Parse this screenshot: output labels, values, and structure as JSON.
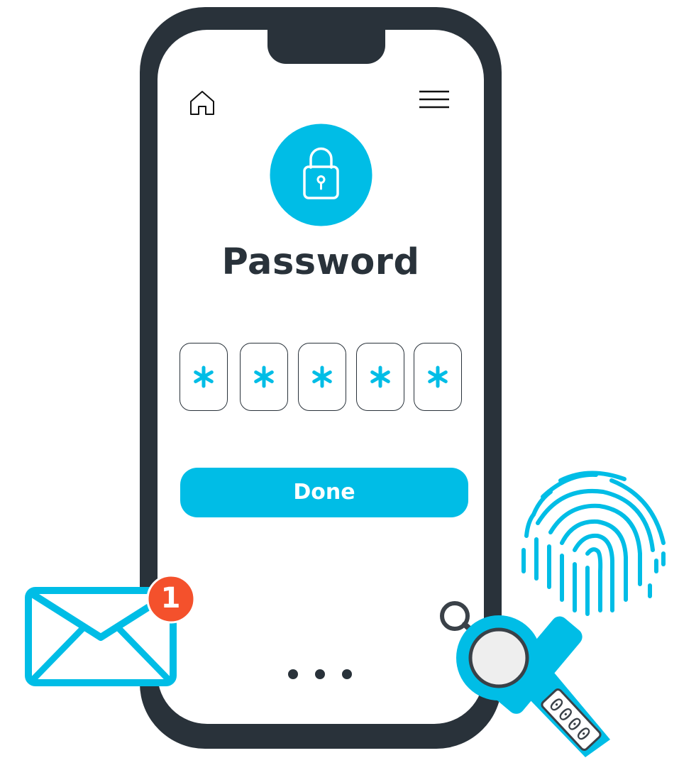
{
  "screen": {
    "title": "Password",
    "pin_chars": [
      "*",
      "*",
      "*",
      "*",
      "*"
    ],
    "done_label": "Done",
    "page_dots": 3
  },
  "notification": {
    "count": "1"
  },
  "key_tag": {
    "text": "0000"
  },
  "icons": {
    "home": "home-icon",
    "menu": "hamburger-menu-icon",
    "lock": "padlock-icon",
    "mail": "envelope-icon",
    "fingerprint": "fingerprint-icon",
    "key": "key-tag-icon"
  },
  "colors": {
    "accent": "#00bde6",
    "dark": "#29323a",
    "badge": "#f4512c",
    "white": "#ffffff"
  }
}
